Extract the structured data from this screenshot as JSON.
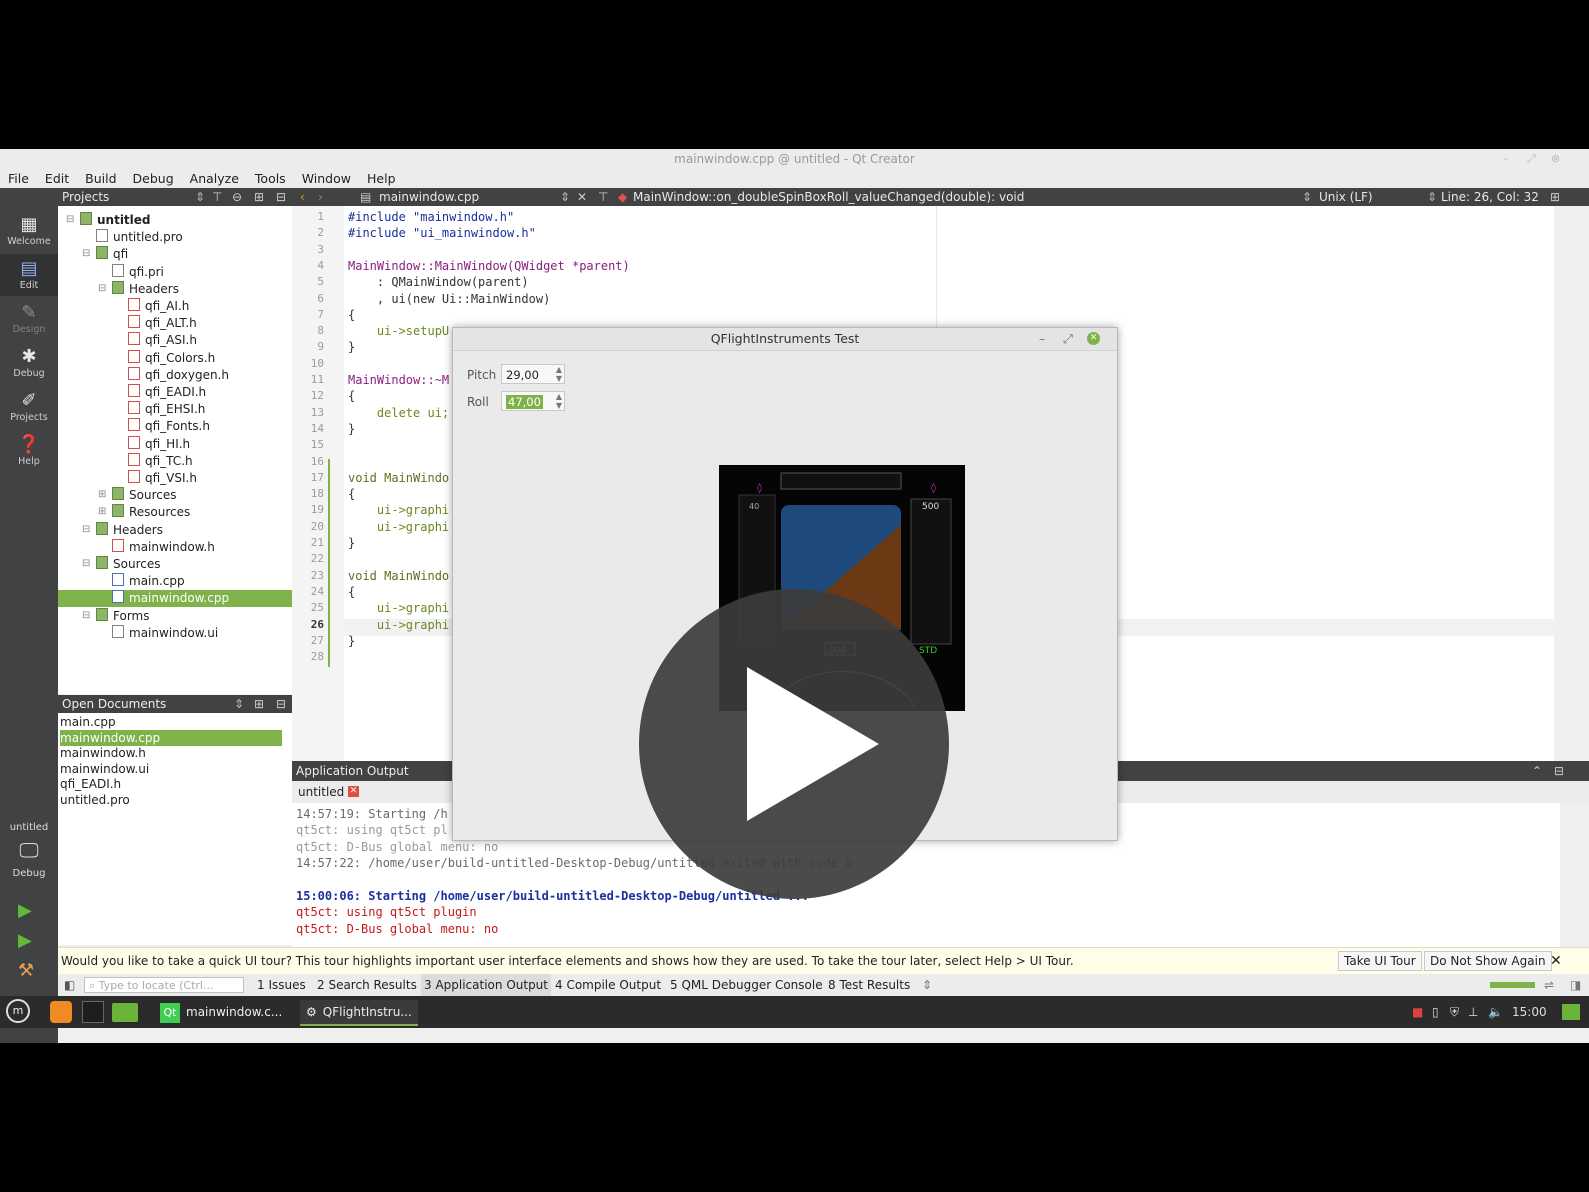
{
  "window": {
    "title": "mainwindow.cpp @ untitled - Qt Creator"
  },
  "menu": [
    "File",
    "Edit",
    "Build",
    "Debug",
    "Analyze",
    "Tools",
    "Window",
    "Help"
  ],
  "toolbar": {
    "projects_label": "Projects",
    "file": "mainwindow.cpp",
    "function": "MainWindow::on_doubleSpinBoxRoll_valueChanged(double): void",
    "line_endings": "Unix (LF)",
    "position": "Line: 26, Col: 32"
  },
  "modes": [
    {
      "label": "Welcome",
      "icon": "grid-icon"
    },
    {
      "label": "Edit",
      "icon": "edit-icon"
    },
    {
      "label": "Design",
      "icon": "pencil-icon"
    },
    {
      "label": "Debug",
      "icon": "bug-icon"
    },
    {
      "label": "Projects",
      "icon": "wrench-icon"
    },
    {
      "label": "Help",
      "icon": "help-icon"
    }
  ],
  "kit": {
    "project": "untitled",
    "mode": "Debug"
  },
  "tree": [
    {
      "label": "untitled",
      "type": "folder",
      "indent": 0,
      "bold": true
    },
    {
      "label": "untitled.pro",
      "type": "pro",
      "indent": 1
    },
    {
      "label": "qfi",
      "type": "folder",
      "indent": 1
    },
    {
      "label": "qfi.pri",
      "type": "pro",
      "indent": 2
    },
    {
      "label": "Headers",
      "type": "folder",
      "indent": 2
    },
    {
      "label": "qfi_AI.h",
      "type": "h",
      "indent": 3
    },
    {
      "label": "qfi_ALT.h",
      "type": "h",
      "indent": 3
    },
    {
      "label": "qfi_ASI.h",
      "type": "h",
      "indent": 3
    },
    {
      "label": "qfi_Colors.h",
      "type": "h",
      "indent": 3
    },
    {
      "label": "qfi_doxygen.h",
      "type": "h",
      "indent": 3
    },
    {
      "label": "qfi_EADI.h",
      "type": "h",
      "indent": 3
    },
    {
      "label": "qfi_EHSI.h",
      "type": "h",
      "indent": 3
    },
    {
      "label": "qfi_Fonts.h",
      "type": "h",
      "indent": 3
    },
    {
      "label": "qfi_HI.h",
      "type": "h",
      "indent": 3
    },
    {
      "label": "qfi_TC.h",
      "type": "h",
      "indent": 3
    },
    {
      "label": "qfi_VSI.h",
      "type": "h",
      "indent": 3
    },
    {
      "label": "Sources",
      "type": "folder",
      "indent": 2
    },
    {
      "label": "Resources",
      "type": "folder",
      "indent": 2
    },
    {
      "label": "Headers",
      "type": "folder",
      "indent": 1
    },
    {
      "label": "mainwindow.h",
      "type": "h",
      "indent": 2
    },
    {
      "label": "Sources",
      "type": "folder",
      "indent": 1
    },
    {
      "label": "main.cpp",
      "type": "cpp",
      "indent": 2
    },
    {
      "label": "mainwindow.cpp",
      "type": "cpp",
      "indent": 2,
      "selected": true
    },
    {
      "label": "Forms",
      "type": "folder",
      "indent": 1
    },
    {
      "label": "mainwindow.ui",
      "type": "pro",
      "indent": 2
    }
  ],
  "open_documents": {
    "title": "Open Documents",
    "items": [
      "main.cpp",
      "mainwindow.cpp",
      "mainwindow.h",
      "mainwindow.ui",
      "qfi_EADI.h",
      "untitled.pro"
    ],
    "selected": 1
  },
  "code": [
    {
      "n": "1",
      "text": "#include \"mainwindow.h\""
    },
    {
      "n": "2",
      "text": "#include \"ui_mainwindow.h\""
    },
    {
      "n": "3",
      "text": ""
    },
    {
      "n": "4",
      "text": "MainWindow::MainWindow(QWidget *parent)"
    },
    {
      "n": "5",
      "text": "    : QMainWindow(parent)"
    },
    {
      "n": "6",
      "text": "    , ui(new Ui::MainWindow)"
    },
    {
      "n": "7",
      "text": "{"
    },
    {
      "n": "8",
      "text": "    ui->setupU"
    },
    {
      "n": "9",
      "text": "}"
    },
    {
      "n": "10",
      "text": ""
    },
    {
      "n": "11",
      "text": "MainWindow::~M"
    },
    {
      "n": "12",
      "text": "{"
    },
    {
      "n": "13",
      "text": "    delete ui;"
    },
    {
      "n": "14",
      "text": "}"
    },
    {
      "n": "15",
      "text": ""
    },
    {
      "n": "16",
      "text": ""
    },
    {
      "n": "17",
      "text": "void MainWindo"
    },
    {
      "n": "18",
      "text": "{"
    },
    {
      "n": "19",
      "text": "    ui->graphi"
    },
    {
      "n": "20",
      "text": "    ui->graphi"
    },
    {
      "n": "21",
      "text": "}"
    },
    {
      "n": "22",
      "text": ""
    },
    {
      "n": "23",
      "text": "void MainWindo"
    },
    {
      "n": "24",
      "text": "{"
    },
    {
      "n": "25",
      "text": "    ui->graphi"
    },
    {
      "n": "26",
      "text": "    ui->graphi"
    },
    {
      "n": "27",
      "text": "}"
    },
    {
      "n": "28",
      "text": ""
    }
  ],
  "output": {
    "title": "Application Output",
    "tab": "untitled",
    "lines": [
      {
        "text": "14:57:19: Starting /h",
        "color": "#6a6a6a"
      },
      {
        "text": "qt5ct: using qt5ct pl",
        "color": "#9a9a9a"
      },
      {
        "text": "qt5ct: D-Bus global menu: no",
        "color": "#9a9a9a"
      },
      {
        "text": "14:57:22: /home/user/build-untitled-Desktop-Debug/untitled exited with code 0",
        "color": "#6a6a6a"
      },
      {
        "text": "",
        "color": "#000"
      },
      {
        "text": "15:00:06: Starting /home/user/build-untitled-Desktop-Debug/untitled ...",
        "color": "#1a2fa0"
      },
      {
        "text": "qt5ct: using qt5ct plugin",
        "color": "#c41a1a"
      },
      {
        "text": "qt5ct: D-Bus global menu: no",
        "color": "#c41a1a"
      }
    ]
  },
  "tour": {
    "message": "Would you like to take a quick UI tour? This tour highlights important user interface elements and shows how they are used. To take the tour later, select Help > UI Tour.",
    "take": "Take UI Tour",
    "dismiss": "Do Not Show Again"
  },
  "status": {
    "locator_placeholder": "Type to locate (Ctrl...",
    "tabs": [
      "1 Issues",
      "2 Search Results",
      "3 Application Output",
      "4 Compile Output",
      "5 QML Debugger Console",
      "8 Test Results"
    ]
  },
  "taskbar": {
    "items": [
      "mainwindow.c...",
      "QFlightInstru..."
    ],
    "clock": "15:00"
  },
  "dialog": {
    "title": "QFlightInstruments Test",
    "pitch_label": "Pitch",
    "pitch_value": "29,00",
    "roll_label": "Roll",
    "roll_value": "47,00"
  },
  "instrument": {
    "alt_label": "500",
    "heading": "000",
    "baro": "STD",
    "speed": "40"
  },
  "colors": {
    "accent": "#7fb34a",
    "sidebar": "#404244",
    "sky": "#1d4a7a",
    "ground": "#6b3a14"
  }
}
